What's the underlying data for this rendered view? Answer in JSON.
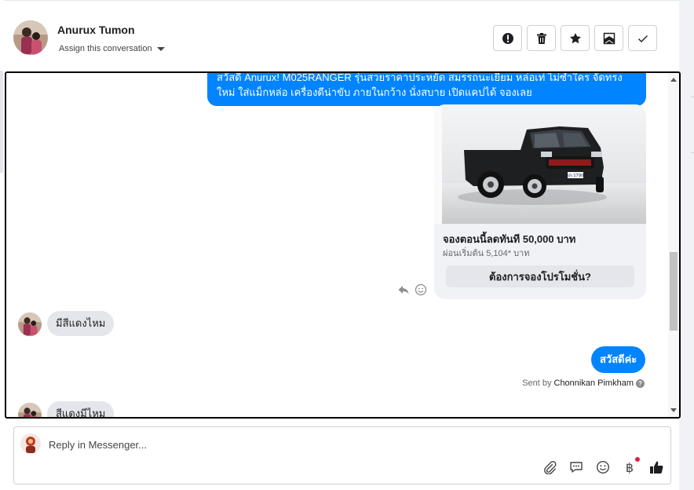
{
  "header": {
    "contact_name": "Anurux Tumon",
    "assign_label": "Assign this conversation",
    "actions": [
      {
        "name": "spam",
        "icon": "alert-circle-icon"
      },
      {
        "name": "delete",
        "icon": "trash-icon"
      },
      {
        "name": "star",
        "icon": "star-icon"
      },
      {
        "name": "mark-unread",
        "icon": "mail-unread-icon"
      },
      {
        "name": "done",
        "icon": "check-icon"
      }
    ]
  },
  "thread": {
    "outgoing_promo": {
      "line1": "สวัสดี Anurux! M025RANGER รุ่นสวยราคาประหยัด สมรรถนะเยี่ยม หล่อเท่ ไม่ซ้ำใคร จัดทรงใหม่ ใส่แม็กหล่อ เครื่องดีน่าขับ ภายในกว้าง นั่งสบาย เปิดแคปได้ จองเลย"
    },
    "card": {
      "title": "จองตอนนี้ลดทันที  50,000 บาท",
      "subtitle": "ผ่อนเริ่มต้น 5,104* บาท",
      "cta": "ต้องการจองโปรโมชั่น?",
      "plate": "ปร 1790"
    },
    "incoming_1": "มีสีแดงไหม",
    "outgoing_reply": "สวัสดีค่ะ",
    "sent_by_prefix": "Sent by",
    "sent_by_agent": "Chonnikan Pimkham",
    "help_mark": "?",
    "incoming_2": "สีแดงมีไหม"
  },
  "composer": {
    "placeholder": "Reply in Messenger...",
    "baht_symbol": "฿"
  },
  "colors": {
    "messenger_blue": "#0084ff",
    "bubble_gray": "#e4e6eb",
    "notification_red": "#e41e3f"
  }
}
